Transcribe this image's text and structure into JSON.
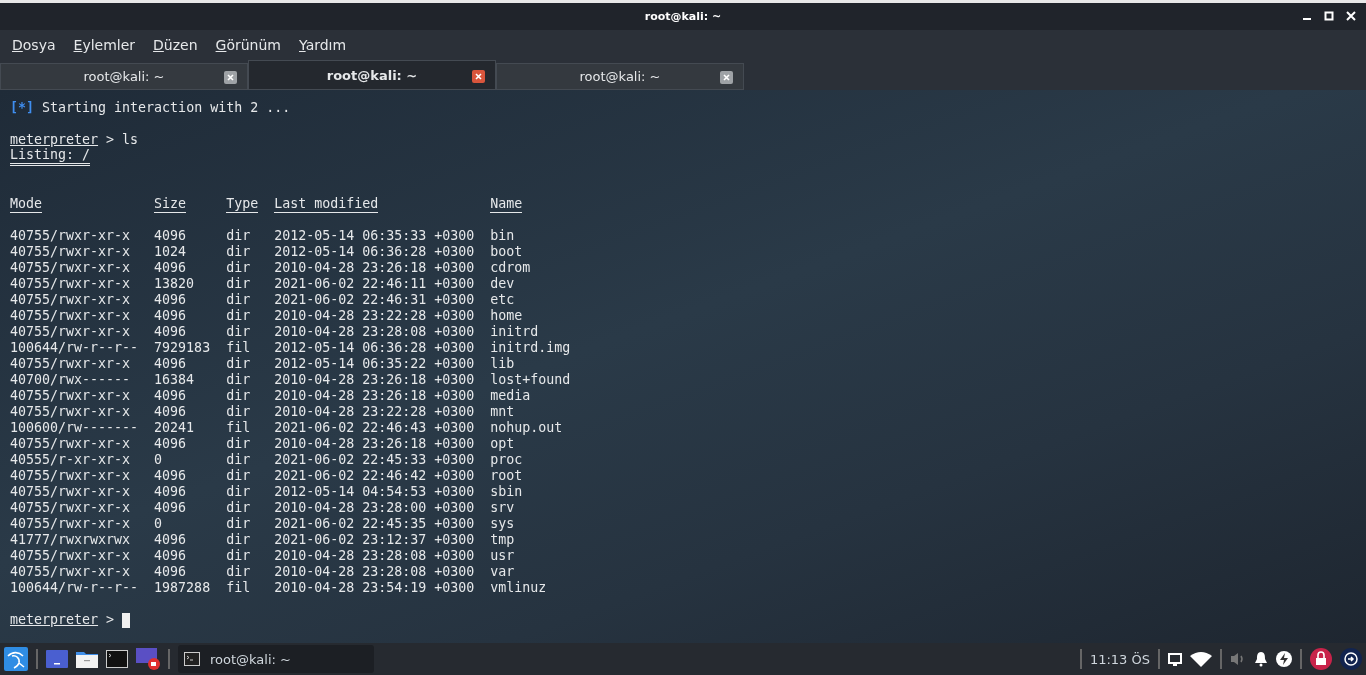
{
  "window": {
    "title": "root@kali: ~"
  },
  "menu": [
    "Dosya",
    "Eylemler",
    "Düzen",
    "Görünüm",
    "Yardım"
  ],
  "tabs": [
    {
      "label": "root@kali: ~",
      "selected": false
    },
    {
      "label": "root@kali: ~",
      "selected": true
    },
    {
      "label": "root@kali: ~",
      "selected": false
    }
  ],
  "terminal": {
    "status_marker": "[*]",
    "status_text": "Starting interaction with 2 ...",
    "prompt": {
      "name": "meterpreter",
      "rest": "> ls"
    },
    "listing_title": "Listing: /",
    "table": {
      "columns": [
        "Mode",
        "Size",
        "Type",
        "Last modified",
        "Name"
      ],
      "rows": [
        [
          "40755/rwxr-xr-x",
          "4096",
          "dir",
          "2012-05-14 06:35:33 +0300",
          "bin"
        ],
        [
          "40755/rwxr-xr-x",
          "1024",
          "dir",
          "2012-05-14 06:36:28 +0300",
          "boot"
        ],
        [
          "40755/rwxr-xr-x",
          "4096",
          "dir",
          "2010-04-28 23:26:18 +0300",
          "cdrom"
        ],
        [
          "40755/rwxr-xr-x",
          "13820",
          "dir",
          "2021-06-02 22:46:11 +0300",
          "dev"
        ],
        [
          "40755/rwxr-xr-x",
          "4096",
          "dir",
          "2021-06-02 22:46:31 +0300",
          "etc"
        ],
        [
          "40755/rwxr-xr-x",
          "4096",
          "dir",
          "2010-04-28 23:22:28 +0300",
          "home"
        ],
        [
          "40755/rwxr-xr-x",
          "4096",
          "dir",
          "2010-04-28 23:28:08 +0300",
          "initrd"
        ],
        [
          "100644/rw-r--r--",
          "7929183",
          "fil",
          "2012-05-14 06:36:28 +0300",
          "initrd.img"
        ],
        [
          "40755/rwxr-xr-x",
          "4096",
          "dir",
          "2012-05-14 06:35:22 +0300",
          "lib"
        ],
        [
          "40700/rwx------",
          "16384",
          "dir",
          "2010-04-28 23:26:18 +0300",
          "lost+found"
        ],
        [
          "40755/rwxr-xr-x",
          "4096",
          "dir",
          "2010-04-28 23:26:18 +0300",
          "media"
        ],
        [
          "40755/rwxr-xr-x",
          "4096",
          "dir",
          "2010-04-28 23:22:28 +0300",
          "mnt"
        ],
        [
          "100600/rw-------",
          "20241",
          "fil",
          "2021-06-02 22:46:43 +0300",
          "nohup.out"
        ],
        [
          "40755/rwxr-xr-x",
          "4096",
          "dir",
          "2010-04-28 23:26:18 +0300",
          "opt"
        ],
        [
          "40555/r-xr-xr-x",
          "0",
          "dir",
          "2021-06-02 22:45:33 +0300",
          "proc"
        ],
        [
          "40755/rwxr-xr-x",
          "4096",
          "dir",
          "2021-06-02 22:46:42 +0300",
          "root"
        ],
        [
          "40755/rwxr-xr-x",
          "4096",
          "dir",
          "2012-05-14 04:54:53 +0300",
          "sbin"
        ],
        [
          "40755/rwxr-xr-x",
          "4096",
          "dir",
          "2010-04-28 23:28:00 +0300",
          "srv"
        ],
        [
          "40755/rwxr-xr-x",
          "0",
          "dir",
          "2021-06-02 22:45:35 +0300",
          "sys"
        ],
        [
          "41777/rwxrwxrwx",
          "4096",
          "dir",
          "2021-06-02 23:12:37 +0300",
          "tmp"
        ],
        [
          "40755/rwxr-xr-x",
          "4096",
          "dir",
          "2010-04-28 23:28:08 +0300",
          "usr"
        ],
        [
          "40755/rwxr-xr-x",
          "4096",
          "dir",
          "2010-04-28 23:28:08 +0300",
          "var"
        ],
        [
          "100644/rw-r--r--",
          "1987288",
          "fil",
          "2010-04-28 23:54:19 +0300",
          "vmlinuz"
        ]
      ]
    },
    "final_prompt": {
      "name": "meterpreter",
      "rest": ">"
    }
  },
  "taskbar": {
    "task": "root@kali: ~",
    "clock": "11:13 ÖS"
  }
}
